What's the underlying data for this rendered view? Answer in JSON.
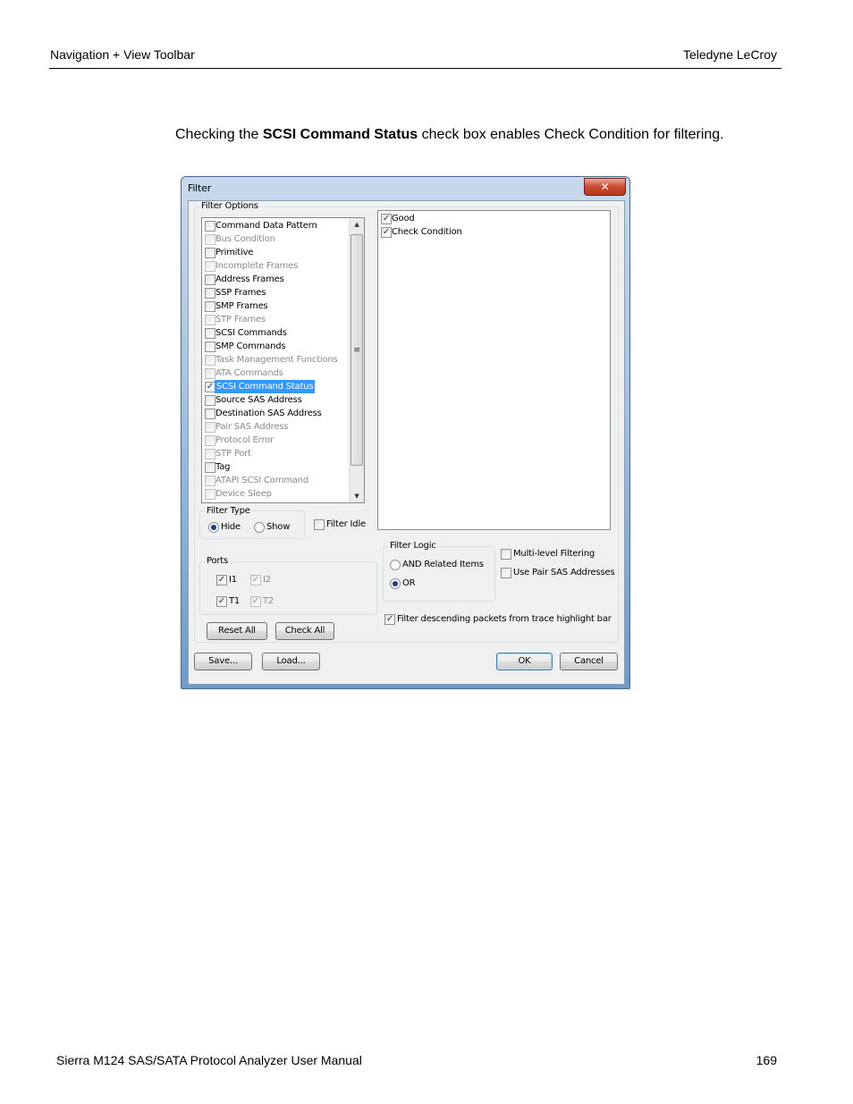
{
  "header": {
    "left": "Navigation + View Toolbar",
    "right": "Teledyne LeCroy"
  },
  "body_text": {
    "prefix": "Checking the ",
    "bold": "SCSI Command Status",
    "suffix": " check box enables Check Condition for filtering."
  },
  "footer": {
    "left": "Sierra M124 SAS/SATA Protocol Analyzer User Manual",
    "right": "169"
  },
  "dialog": {
    "title": "Filter",
    "close_glyph": "✕",
    "filter_options_label": "Filter Options",
    "options": [
      {
        "label": "Command Data Pattern",
        "checked": false,
        "enabled": true
      },
      {
        "label": "Bus Condition",
        "checked": false,
        "enabled": false
      },
      {
        "label": "Primitive",
        "checked": false,
        "enabled": true
      },
      {
        "label": "Incomplete Frames",
        "checked": false,
        "enabled": false
      },
      {
        "label": "Address Frames",
        "checked": false,
        "enabled": true
      },
      {
        "label": "SSP Frames",
        "checked": false,
        "enabled": true
      },
      {
        "label": "SMP Frames",
        "checked": false,
        "enabled": true
      },
      {
        "label": "STP Frames",
        "checked": false,
        "enabled": false
      },
      {
        "label": "SCSI Commands",
        "checked": false,
        "enabled": true
      },
      {
        "label": "SMP Commands",
        "checked": false,
        "enabled": true
      },
      {
        "label": "Task Management Functions",
        "checked": false,
        "enabled": false
      },
      {
        "label": "ATA Commands",
        "checked": false,
        "enabled": false
      },
      {
        "label": "SCSI Command Status",
        "checked": true,
        "enabled": true,
        "selected": true
      },
      {
        "label": "Source SAS Address",
        "checked": false,
        "enabled": true
      },
      {
        "label": "Destination SAS Address",
        "checked": false,
        "enabled": true
      },
      {
        "label": "Pair SAS Address",
        "checked": false,
        "enabled": false
      },
      {
        "label": "Protocol Error",
        "checked": false,
        "enabled": false
      },
      {
        "label": "STP Port",
        "checked": false,
        "enabled": false
      },
      {
        "label": "Tag",
        "checked": false,
        "enabled": true
      },
      {
        "label": "ATAPI SCSI Command",
        "checked": false,
        "enabled": false
      },
      {
        "label": "Device Sleep",
        "checked": false,
        "enabled": false
      }
    ],
    "status_items": [
      {
        "label": "Good",
        "checked": true
      },
      {
        "label": "Check Condition",
        "checked": true
      }
    ],
    "filter_type": {
      "label": "Filter Type",
      "hide": "Hide",
      "show": "Show",
      "selected": "Hide"
    },
    "filter_idle": {
      "label": "Filter Idle",
      "checked": false
    },
    "ports": {
      "label": "Ports",
      "items": [
        {
          "label": "I1",
          "checked": true,
          "enabled": true
        },
        {
          "label": "I2",
          "checked": true,
          "enabled": false
        },
        {
          "label": "T1",
          "checked": true,
          "enabled": true
        },
        {
          "label": "T2",
          "checked": true,
          "enabled": false
        }
      ]
    },
    "filter_logic": {
      "label": "Filter Logic",
      "and": "AND Related Items",
      "or": "OR",
      "selected": "OR"
    },
    "multi_level": {
      "label": "Multi-level Filtering",
      "checked": false
    },
    "pair_sas": {
      "label": "Use Pair SAS Addresses",
      "checked": false
    },
    "descending": {
      "label": "Filter descending packets from trace highlight bar",
      "checked": true
    },
    "buttons": {
      "reset_all": "Reset All",
      "check_all": "Check All",
      "save": "Save...",
      "load": "Load...",
      "ok": "OK",
      "cancel": "Cancel"
    },
    "check_glyph": "✓"
  }
}
